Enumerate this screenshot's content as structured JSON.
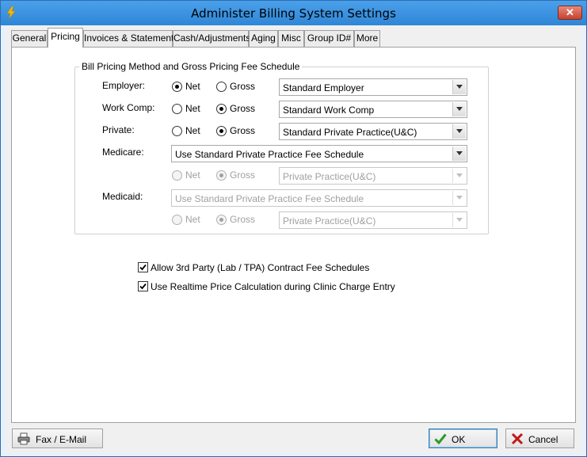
{
  "window": {
    "title": "Administer Billing System Settings",
    "close_label": "✕"
  },
  "tabs": [
    {
      "label": "General"
    },
    {
      "label": "Pricing"
    },
    {
      "label": "Invoices & Statements"
    },
    {
      "label": "Cash/Adjustments"
    },
    {
      "label": "Aging"
    },
    {
      "label": "Misc"
    },
    {
      "label": "Group ID#"
    },
    {
      "label": "More"
    }
  ],
  "active_tab": "Pricing",
  "group": {
    "title": "Bill Pricing Method and Gross Pricing Fee Schedule",
    "net_label": "Net",
    "gross_label": "Gross",
    "rows": {
      "employer": {
        "label": "Employer:",
        "selected": "Net",
        "schedule": "Standard Employer"
      },
      "workcomp": {
        "label": "Work Comp:",
        "selected": "Gross",
        "schedule": "Standard Work Comp"
      },
      "private": {
        "label": "Private:",
        "selected": "Gross",
        "schedule": "Standard Private Practice(U&C)"
      },
      "medicare": {
        "label": "Medicare:",
        "source": "Use Standard Private Practice Fee Schedule",
        "selected": "Gross",
        "schedule": "Private Practice(U&C)",
        "enabled": false
      },
      "medicaid": {
        "label": "Medicaid:",
        "source": "Use Standard Private Practice Fee Schedule",
        "selected": "Gross",
        "schedule": "Private Practice(U&C)",
        "enabled": false
      }
    }
  },
  "options": {
    "third_party": {
      "label": "Allow 3rd Party (Lab / TPA) Contract Fee Schedules",
      "checked": true
    },
    "realtime": {
      "label": "Use Realtime Price Calculation during Clinic Charge Entry",
      "checked": true
    }
  },
  "footer": {
    "fax_label": "Fax / E-Mail",
    "ok_label": "OK",
    "cancel_label": "Cancel"
  },
  "colors": {
    "titlebar": "#3a92de",
    "ok_check": "#2a9a2a",
    "cancel_x": "#c01818"
  }
}
